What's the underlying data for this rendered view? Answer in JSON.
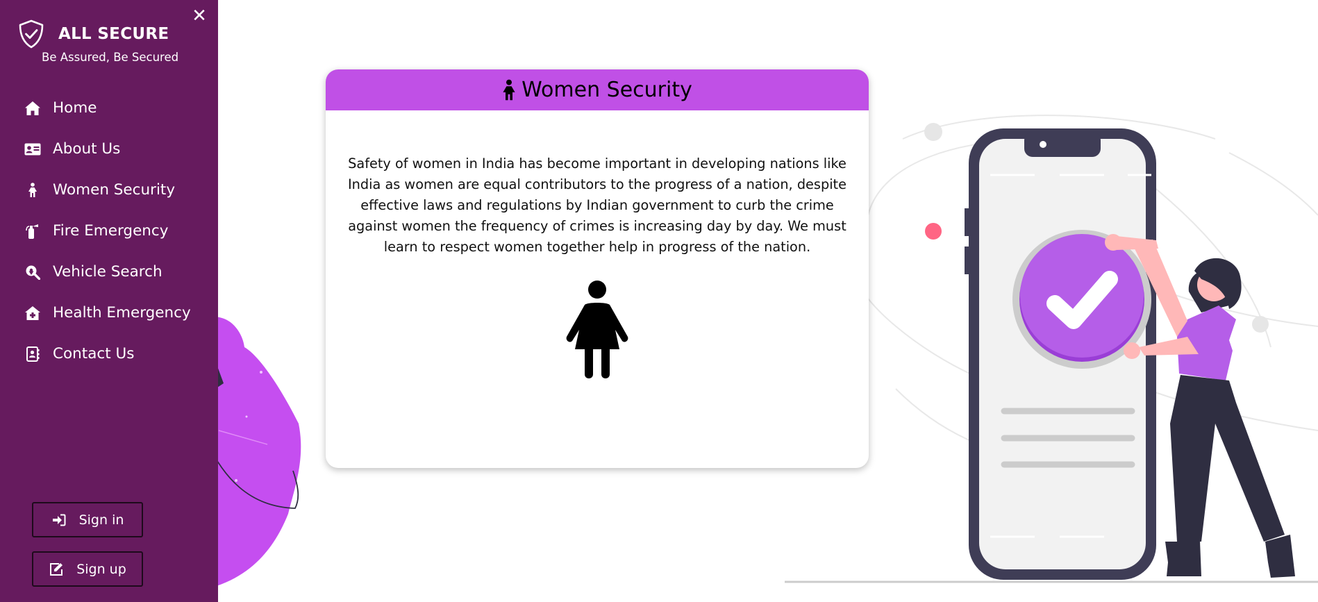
{
  "sidebar": {
    "brand_title": "ALL SECURE",
    "brand_tagline": "Be Assured, Be Secured",
    "close_glyph": "✕",
    "nav": [
      {
        "label": "Home",
        "icon": "home-icon"
      },
      {
        "label": "About Us",
        "icon": "id-card-icon"
      },
      {
        "label": "Women Security",
        "icon": "female-icon"
      },
      {
        "label": "Fire Emergency",
        "icon": "fire-extinguisher-icon"
      },
      {
        "label": "Vehicle Search",
        "icon": "search-location-icon"
      },
      {
        "label": "Health Emergency",
        "icon": "clinic-icon"
      },
      {
        "label": "Contact Us",
        "icon": "address-book-icon"
      }
    ],
    "signin_label": "Sign in",
    "signup_label": "Sign up"
  },
  "card": {
    "title": "Women Security",
    "body": "Safety of women in India has become important in developing nations like India as women are equal contributors to the progress of a nation, despite effective laws and regulations by Indian government to curb the crime against women the frequency of crimes is increasing day by day. We must learn to respect women together help in progress of the nation."
  },
  "colors": {
    "sidebar_bg": "#661b5e",
    "card_header": "#c050e6",
    "accent_purple": "#b55ee8",
    "illustration_dark": "#3f3d56",
    "dot_red": "#ff6584"
  }
}
